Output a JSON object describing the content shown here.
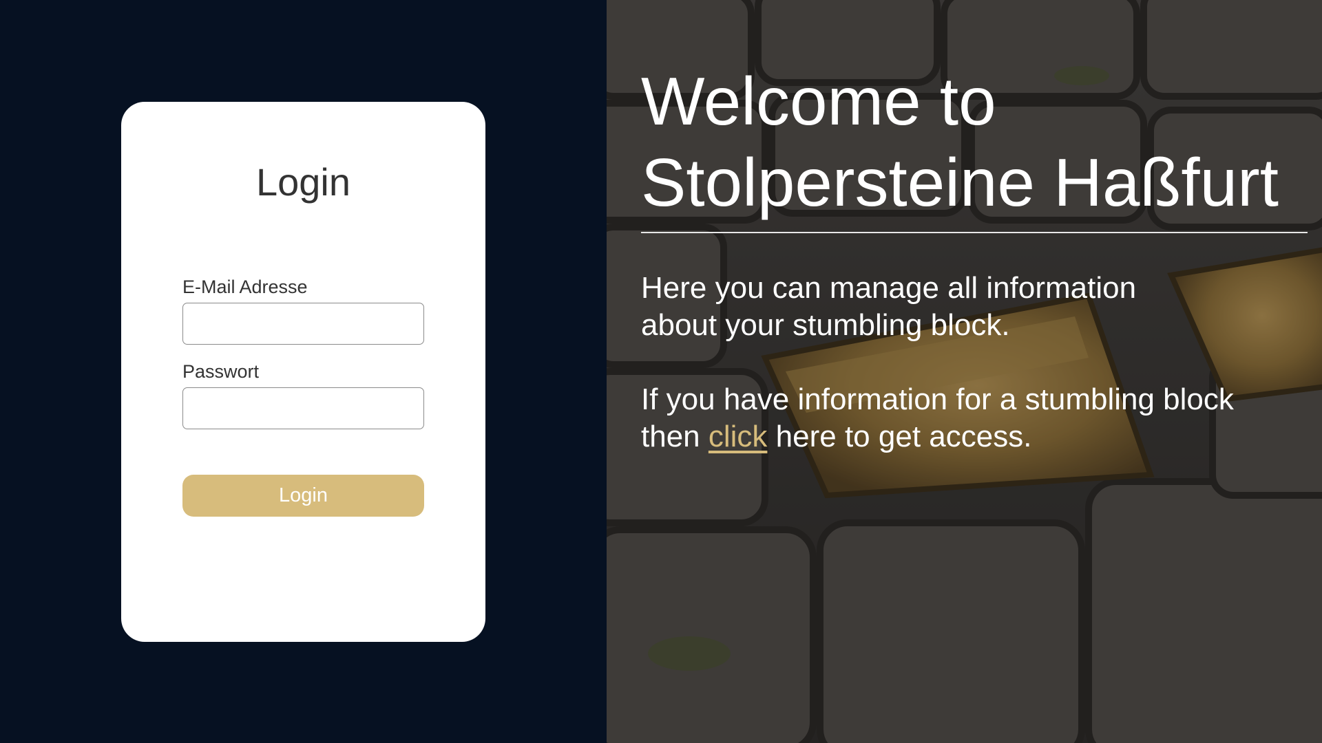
{
  "login": {
    "title": "Login",
    "email_label": "E-Mail Adresse",
    "email_value": "",
    "password_label": "Passwort",
    "password_value": "",
    "button_label": "Login"
  },
  "hero": {
    "heading_line1": "Welcome to",
    "heading_line2": "Stolpersteine Haßfurt",
    "intro_line1": "Here you can manage all information",
    "intro_line2": "about your stumbling block.",
    "access_line1": "If you have information for a stumbling block",
    "access_prefix": "then ",
    "access_link": "click",
    "access_suffix": " here to get access."
  },
  "colors": {
    "left_background": "#061122",
    "accent": "#d7bc7c",
    "card_background": "#ffffff"
  }
}
